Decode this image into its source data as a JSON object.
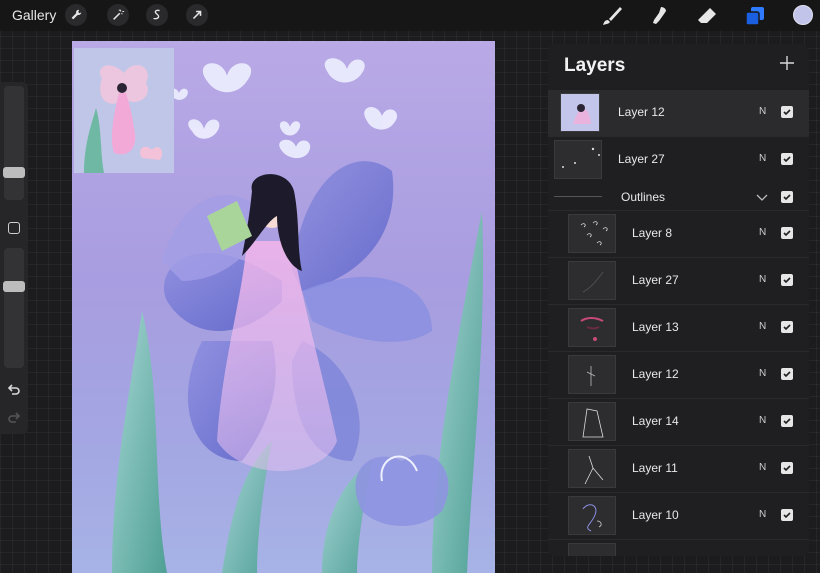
{
  "toolbar": {
    "gallery_label": "Gallery",
    "left_icons": [
      "wrench-icon",
      "magic-wand-icon",
      "selection-icon",
      "transform-arrow-icon"
    ],
    "right_tools": [
      "brush-icon",
      "smudge-icon",
      "eraser-icon",
      "layers-icon"
    ],
    "active_color": "#c3c4ea"
  },
  "sidebar": {
    "brush_size_level": 0.75,
    "opacity_level": 0.6
  },
  "layers_panel": {
    "title": "Layers",
    "top_layers": [
      {
        "name": "Layer 12",
        "blend": "N",
        "visible": true,
        "selected": true
      },
      {
        "name": "Layer 27",
        "blend": "N",
        "visible": true,
        "selected": false
      }
    ],
    "group": {
      "name": "Outlines",
      "visible": true,
      "expanded": true
    },
    "group_layers": [
      {
        "name": "Layer 8",
        "blend": "N",
        "visible": true
      },
      {
        "name": "Layer 27",
        "blend": "N",
        "visible": true
      },
      {
        "name": "Layer 13",
        "blend": "N",
        "visible": true
      },
      {
        "name": "Layer 12",
        "blend": "N",
        "visible": true
      },
      {
        "name": "Layer 14",
        "blend": "N",
        "visible": true
      },
      {
        "name": "Layer 11",
        "blend": "N",
        "visible": true
      },
      {
        "name": "Layer 10",
        "blend": "N",
        "visible": true
      }
    ]
  }
}
